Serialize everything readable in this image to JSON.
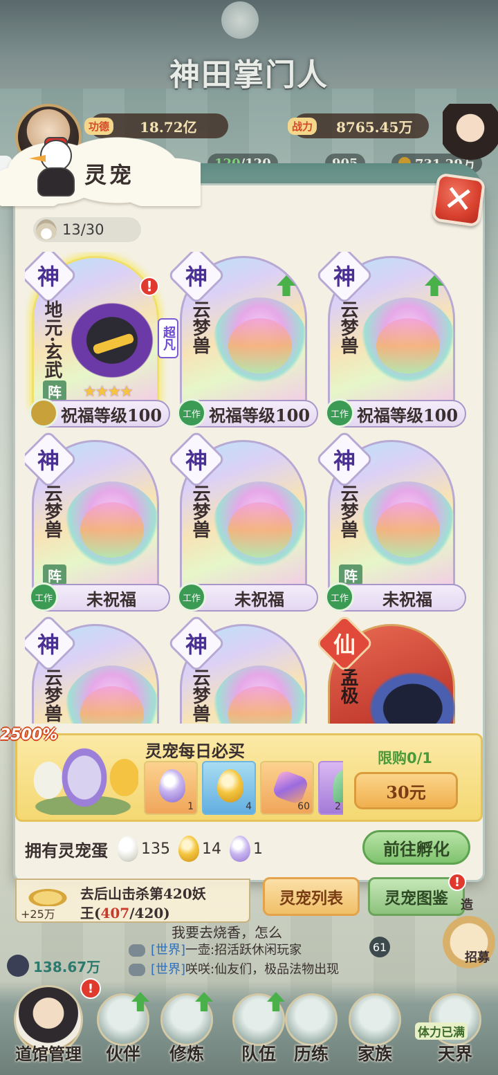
{
  "header": {
    "game_title": "神田掌门人",
    "merit_label": "功德",
    "merit_value": "18.72亿",
    "battle_label": "战力",
    "battle_value": "8765.45万",
    "stamina_current": "120",
    "stamina_max": "/120",
    "jade": "905",
    "coins": "731.29万"
  },
  "panel": {
    "title": "灵宠",
    "pet_count": "13/30",
    "close_icon": "close-x-icon"
  },
  "pets": [
    {
      "rank": "神",
      "name": "地元·玄武",
      "tier": "超凡",
      "status": "祝福等级100",
      "lineup": "阵",
      "status_icon": "shield",
      "alert": "!",
      "stars": "★★★★"
    },
    {
      "rank": "神",
      "name": "云梦兽",
      "status": "祝福等级100",
      "status_icon": "工作",
      "upgrade": true
    },
    {
      "rank": "神",
      "name": "云梦兽",
      "status": "祝福等级100",
      "status_icon": "工作",
      "upgrade": true
    },
    {
      "rank": "神",
      "name": "云梦兽",
      "status": "未祝福",
      "lineup": "阵",
      "status_icon": "工作"
    },
    {
      "rank": "神",
      "name": "云梦兽",
      "status": "未祝福",
      "status_icon": "工作"
    },
    {
      "rank": "神",
      "name": "云梦兽",
      "status": "未祝福",
      "lineup": "阵",
      "status_icon": "工作"
    },
    {
      "rank": "神",
      "name": "云梦兽"
    },
    {
      "rank": "神",
      "name": "云梦兽"
    },
    {
      "rank": "仙",
      "name": "孟极"
    }
  ],
  "daily": {
    "bonus_tag": "2500%",
    "title": "灵宠每日必买",
    "items": [
      {
        "icon": "purple-egg-icon",
        "qty": "1"
      },
      {
        "icon": "gold-egg-icon",
        "qty": "4"
      },
      {
        "icon": "crystal-icon",
        "qty": "60"
      },
      {
        "icon": "leaf-icon",
        "qty": "2"
      }
    ],
    "limit": "限购0/1",
    "price": "30元"
  },
  "eggs": {
    "label": "拥有灵宠蛋",
    "white": "135",
    "gold": "14",
    "purple": "1",
    "hatch_button": "前往孵化"
  },
  "tabs": {
    "list": "灵宠列表",
    "book": "灵宠图鉴",
    "book_alert": "!"
  },
  "hud": {
    "task_line1": "去后山击杀第420妖",
    "task_line2_a": "王(",
    "task_progress": "407",
    "task_line2_b": "/420)",
    "task_bonus": "+25万",
    "speech": "我要去烧香，怎么",
    "chat": [
      {
        "channel": "[世界]",
        "text": "一壶:招活跃休闲玩家"
      },
      {
        "channel": "[世界]",
        "text": "咲咲:仙友们，极品法物出现"
      }
    ],
    "chat_count": "61",
    "power_small": "138.67万",
    "recruit": "招募",
    "side_text": "造"
  },
  "nav": {
    "items": [
      "道馆管理",
      "伙伴",
      "修炼",
      "队伍",
      "历练",
      "家族",
      "天界"
    ],
    "first_alert": "!",
    "stamina_full": "体力已满"
  }
}
